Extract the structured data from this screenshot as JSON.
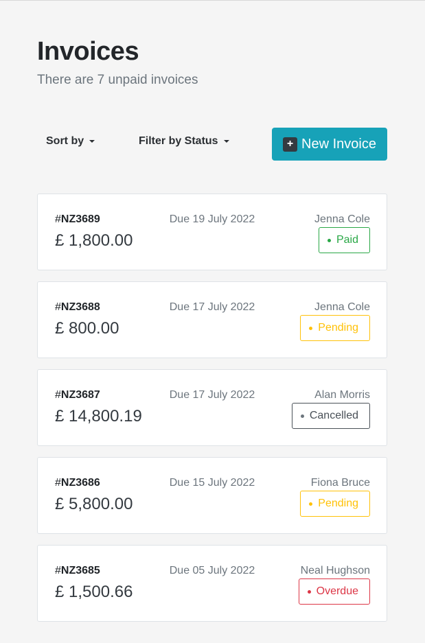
{
  "header": {
    "title": "Invoices",
    "subtitle": "There are 7 unpaid invoices"
  },
  "toolbar": {
    "sort_label": "Sort by",
    "filter_label": "Filter by Status",
    "new_invoice_label": "New Invoice",
    "new_invoice_icon": "plus-icon",
    "accent_color": "#17a2b8"
  },
  "status_colors": {
    "Paid": "#28a745",
    "Pending": "#ffc107",
    "Cancelled": "#6c757d",
    "Overdue": "#dc3545"
  },
  "invoices": [
    {
      "hash": "#",
      "id": "NZ3689",
      "due": "Due 19 July 2022",
      "amount": "£ 1,800.00",
      "client": "Jenna Cole",
      "status": "Paid"
    },
    {
      "hash": "#",
      "id": "NZ3688",
      "due": "Due 17 July 2022",
      "amount": "£ 800.00",
      "client": "Jenna Cole",
      "status": "Pending"
    },
    {
      "hash": "#",
      "id": "NZ3687",
      "due": "Due 17 July 2022",
      "amount": "£ 14,800.19",
      "client": "Alan Morris",
      "status": "Cancelled"
    },
    {
      "hash": "#",
      "id": "NZ3686",
      "due": "Due 15 July 2022",
      "amount": "£ 5,800.00",
      "client": "Fiona Bruce",
      "status": "Pending"
    },
    {
      "hash": "#",
      "id": "NZ3685",
      "due": "Due 05 July 2022",
      "amount": "£ 1,500.66",
      "client": "Neal Hughson",
      "status": "Overdue"
    }
  ]
}
